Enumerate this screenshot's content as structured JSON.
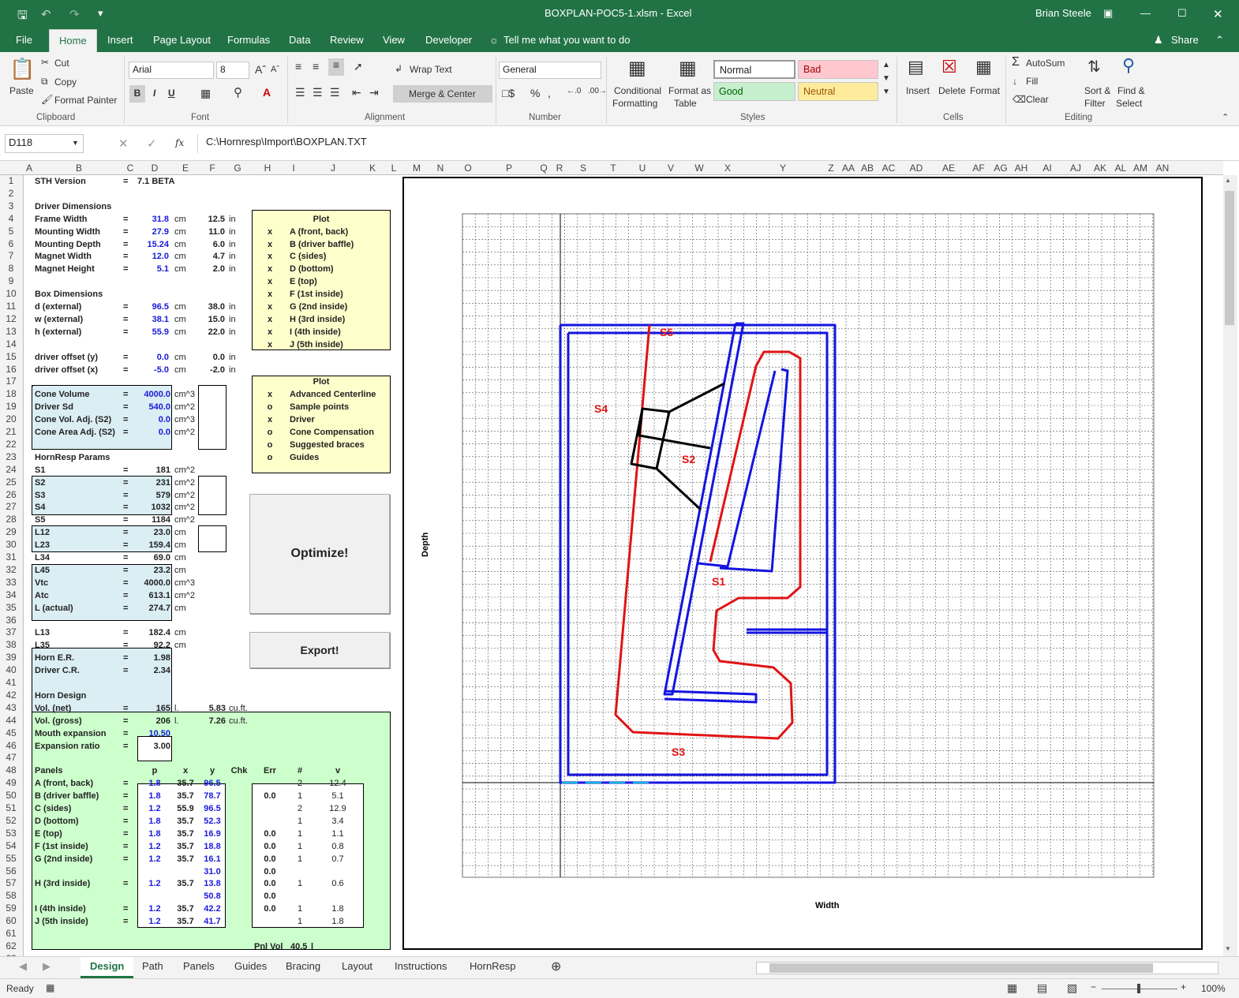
{
  "window": {
    "title": "BOXPLAN-POC5-1.xlsm  -  Excel",
    "user": "Brian Steele"
  },
  "menu": {
    "file": "File",
    "home": "Home",
    "insert": "Insert",
    "page_layout": "Page Layout",
    "formulas": "Formulas",
    "data": "Data",
    "review": "Review",
    "view": "View",
    "developer": "Developer",
    "tell_me": "Tell me what you want to do",
    "share": "Share"
  },
  "ribbon": {
    "clipboard": {
      "paste": "Paste",
      "cut": "Cut",
      "copy": "Copy",
      "format_painter": "Format Painter",
      "group": "Clipboard"
    },
    "font": {
      "name": "Arial",
      "size": "8",
      "group": "Font",
      "bold": "B",
      "italic": "I",
      "underline": "U"
    },
    "alignment": {
      "wrap": "Wrap Text",
      "merge": "Merge & Center",
      "group": "Alignment"
    },
    "number": {
      "format": "General",
      "group": "Number",
      "percent": "%"
    },
    "styles": {
      "cond1": "Conditional",
      "cond2": "Formatting",
      "fmt1": "Format as",
      "fmt2": "Table",
      "normal": "Normal",
      "bad": "Bad",
      "good": "Good",
      "neutral": "Neutral",
      "group": "Styles"
    },
    "cells": {
      "insert": "Insert",
      "delete": "Delete",
      "format": "Format",
      "group": "Cells"
    },
    "editing": {
      "autosum": "AutoSum",
      "fill": "Fill",
      "clear": "Clear",
      "sort1": "Sort &",
      "sort2": "Filter",
      "find1": "Find &",
      "find2": "Select",
      "group": "Editing"
    }
  },
  "formula_bar": {
    "name_box": "D118",
    "fx": "fx",
    "formula": "C:\\Hornresp\\Import\\BOXPLAN.TXT"
  },
  "columns": [
    "A",
    "B",
    "C",
    "D",
    "E",
    "F",
    "G",
    "H",
    "I",
    "J",
    "K",
    "L",
    "M",
    "N",
    "O",
    "P",
    "Q",
    "R",
    "S",
    "T",
    "U",
    "V",
    "W",
    "X",
    "Y",
    "Z",
    "AA",
    "AB",
    "AC",
    "AD",
    "AE",
    "AF",
    "AG",
    "AH",
    "AI",
    "AJ",
    "AK",
    "AL",
    "AM",
    "AN"
  ],
  "rows": [
    "1",
    "2",
    "3",
    "4",
    "5",
    "6",
    "7",
    "8",
    "9",
    "10",
    "11",
    "12",
    "13",
    "14",
    "15",
    "16",
    "17",
    "18",
    "19",
    "20",
    "21",
    "22",
    "23",
    "24",
    "25",
    "26",
    "27",
    "28",
    "29",
    "30",
    "31",
    "32",
    "33",
    "34",
    "35",
    "36",
    "37",
    "38",
    "39",
    "40",
    "41",
    "42",
    "43",
    "44",
    "45",
    "46",
    "47",
    "48",
    "49",
    "50",
    "51",
    "52",
    "53",
    "54",
    "55",
    "56",
    "57",
    "58",
    "59",
    "60",
    "61",
    "62",
    "63"
  ],
  "sheet": {
    "sth_label": "STH Version",
    "eq": "=",
    "sth_value": "7.1 BETA",
    "driver_dims_title": "Driver Dimensions",
    "driver_dims": [
      {
        "label": "Frame Width",
        "cm": "31.8",
        "in": "12.5"
      },
      {
        "label": "Mounting Width",
        "cm": "27.9",
        "in": "11.0"
      },
      {
        "label": "Mounting Depth",
        "cm": "15.24",
        "in": "6.0"
      },
      {
        "label": "Magnet Width",
        "cm": "12.0",
        "in": "4.7"
      },
      {
        "label": "Magnet Height",
        "cm": "5.1",
        "in": "2.0"
      }
    ],
    "box_dims_title": "Box Dimensions",
    "box_dims": [
      {
        "label": "d (external)",
        "cm": "96.5",
        "in": "38.0"
      },
      {
        "label": "w (external)",
        "cm": "38.1",
        "in": "15.0"
      },
      {
        "label": "h (external)",
        "cm": "55.9",
        "in": "22.0"
      }
    ],
    "offsets": [
      {
        "label": "driver offset (y)",
        "cm": "0.0",
        "in": "0.0"
      },
      {
        "label": "driver offset (x)",
        "cm": "-5.0",
        "in": "-2.0"
      }
    ],
    "unit_cm": "cm",
    "unit_in": "in",
    "cone": [
      {
        "label": "Cone Volume",
        "value": "4000.0",
        "unit": "cm^3"
      },
      {
        "label": "Driver Sd",
        "value": "540.0",
        "unit": "cm^2"
      },
      {
        "label": "Cone Vol. Adj. (S2)",
        "value": "0.0",
        "unit": "cm^3"
      },
      {
        "label": "Cone Area Adj. (S2)",
        "value": "0.0",
        "unit": "cm^2"
      }
    ],
    "hornresp_title": "HornResp Params",
    "hornresp": [
      {
        "label": "S1",
        "value": "181",
        "unit": "cm^2"
      },
      {
        "label": "S2",
        "value": "231",
        "unit": "cm^2"
      },
      {
        "label": "S3",
        "value": "579",
        "unit": "cm^2"
      },
      {
        "label": "S4",
        "value": "1032",
        "unit": "cm^2"
      },
      {
        "label": "S5",
        "value": "1184",
        "unit": "cm^2"
      },
      {
        "label": "L12",
        "value": "23.0",
        "unit": "cm"
      },
      {
        "label": "L23",
        "value": "159.4",
        "unit": "cm"
      },
      {
        "label": "L34",
        "value": "69.0",
        "unit": "cm"
      },
      {
        "label": "L45",
        "value": "23.2",
        "unit": "cm"
      },
      {
        "label": "Vtc",
        "value": "4000.0",
        "unit": "cm^3"
      },
      {
        "label": "Atc",
        "value": "613.1",
        "unit": "cm^2"
      },
      {
        "label": "L (actual)",
        "value": "274.7",
        "unit": "cm"
      }
    ],
    "extra": [
      {
        "label": "L13",
        "value": "182.4",
        "unit": "cm"
      },
      {
        "label": "L35",
        "value": "92.2",
        "unit": "cm"
      },
      {
        "label": "Horn E.R.",
        "value": "1.98",
        "unit": ""
      },
      {
        "label": "Driver C.R.",
        "value": "2.34",
        "unit": ""
      }
    ],
    "plot1_title": "Plot",
    "plot1": [
      {
        "mark": "x",
        "label": "A (front, back)"
      },
      {
        "mark": "x",
        "label": "B (driver baffle)"
      },
      {
        "mark": "x",
        "label": "C (sides)"
      },
      {
        "mark": "x",
        "label": "D (bottom)"
      },
      {
        "mark": "x",
        "label": "E (top)"
      },
      {
        "mark": "x",
        "label": "F (1st inside)"
      },
      {
        "mark": "x",
        "label": "G (2nd inside)"
      },
      {
        "mark": "x",
        "label": "H (3rd inside)"
      },
      {
        "mark": "x",
        "label": "I (4th inside)"
      },
      {
        "mark": "x",
        "label": "J (5th inside)"
      }
    ],
    "plot2_title": "Plot",
    "plot2": [
      {
        "mark": "x",
        "label": "Advanced Centerline"
      },
      {
        "mark": "o",
        "label": "Sample points"
      },
      {
        "mark": "x",
        "label": "Driver"
      },
      {
        "mark": "o",
        "label": "Cone Compensation"
      },
      {
        "mark": "o",
        "label": "Suggested braces"
      },
      {
        "mark": "o",
        "label": "Guides"
      }
    ],
    "optimize": "Optimize!",
    "export": "Export!",
    "horn_design_title": "Horn Design",
    "vol_net": {
      "label": "Vol. (net)",
      "l": "165",
      "l_unit": "l.",
      "cuft": "5.83",
      "cuft_unit": "cu.ft."
    },
    "vol_gross": {
      "label": "Vol. (gross)",
      "l": "206",
      "l_unit": "l.",
      "cuft": "7.26",
      "cuft_unit": "cu.ft."
    },
    "mouth_exp": {
      "label": "Mouth expansion",
      "value": "10.50"
    },
    "exp_ratio": {
      "label": "Expansion ratio",
      "value": "3.00"
    },
    "panels_hdr": {
      "panels": "Panels",
      "p": "p",
      "x": "x",
      "y": "y",
      "chk": "Chk",
      "err": "Err",
      "n": "#",
      "v": "v"
    },
    "panels": [
      {
        "label": "A (front, back)",
        "p": "1.8",
        "x": "35.7",
        "y": "96.5",
        "err": "",
        "n": "2",
        "v": "12.4"
      },
      {
        "label": "B (driver baffle)",
        "p": "1.8",
        "x": "35.7",
        "y": "78.7",
        "err": "0.0",
        "n": "1",
        "v": "5.1"
      },
      {
        "label": "C (sides)",
        "p": "1.2",
        "x": "55.9",
        "y": "96.5",
        "err": "",
        "n": "2",
        "v": "12.9"
      },
      {
        "label": "D (bottom)",
        "p": "1.8",
        "x": "35.7",
        "y": "52.3",
        "err": "",
        "n": "1",
        "v": "3.4"
      },
      {
        "label": "E (top)",
        "p": "1.8",
        "x": "35.7",
        "y": "16.9",
        "err": "0.0",
        "n": "1",
        "v": "1.1"
      },
      {
        "label": "F (1st inside)",
        "p": "1.2",
        "x": "35.7",
        "y": "18.8",
        "err": "0.0",
        "n": "1",
        "v": "0.8"
      },
      {
        "label": "G (2nd inside)",
        "p": "1.2",
        "x": "35.7",
        "y": "16.1",
        "err": "0.0",
        "n": "1",
        "v": "0.7"
      },
      {
        "label": "",
        "p": "",
        "x": "",
        "y": "31.0",
        "err": "0.0",
        "n": "",
        "v": ""
      },
      {
        "label": "H (3rd inside)",
        "p": "1.2",
        "x": "35.7",
        "y": "13.8",
        "err": "0.0",
        "n": "1",
        "v": "0.6"
      },
      {
        "label": "",
        "p": "",
        "x": "",
        "y": "50.8",
        "err": "0.0",
        "n": "",
        "v": ""
      },
      {
        "label": "I (4th inside)",
        "p": "1.2",
        "x": "35.7",
        "y": "42.2",
        "err": "0.0",
        "n": "1",
        "v": "1.8"
      },
      {
        "label": "J (5th inside)",
        "p": "1.2",
        "x": "35.7",
        "y": "41.7",
        "err": "",
        "n": "1",
        "v": "1.8"
      }
    ],
    "pnl_vol": {
      "label": "Pnl Vol",
      "value": "40.5",
      "unit": "l"
    }
  },
  "chart": {
    "xlabel": "Width",
    "ylabel": "Depth",
    "labels": {
      "s1": "S1",
      "s2": "S2",
      "s3": "S3",
      "s4": "S4",
      "s5": "S5"
    },
    "color_blue": "#1414e0",
    "color_red": "#e01414"
  },
  "tabs": [
    "Design",
    "Path",
    "Panels",
    "Guides",
    "Bracing",
    "Layout",
    "Instructions",
    "HornResp"
  ],
  "status": {
    "ready": "Ready",
    "zoom": "100%"
  }
}
